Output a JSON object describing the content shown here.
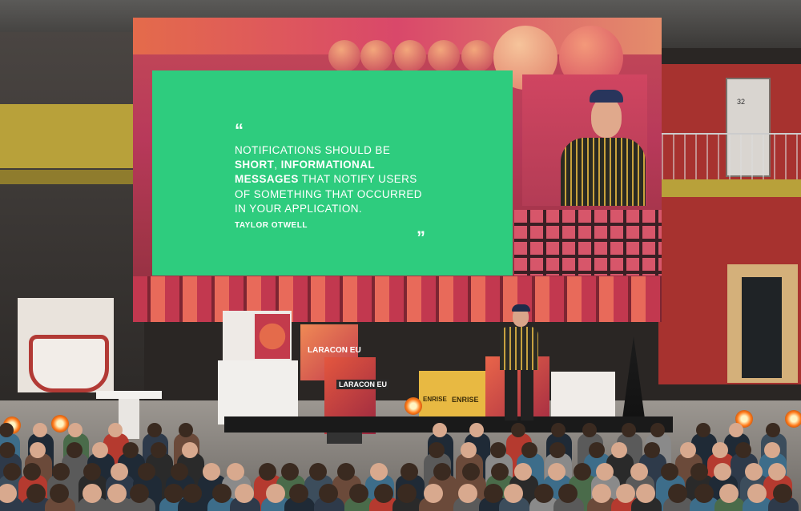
{
  "slide": {
    "quote_open": "“",
    "quote_line1": "NOTIFICATIONS SHOULD BE",
    "quote_bold1": "SHORT",
    "quote_sep": ", ",
    "quote_bold2": "INFORMATIONAL",
    "quote_bold3": "MESSAGES",
    "quote_line3_rest": " THAT NOTIFY USERS",
    "quote_line4": "OF SOMETHING THAT OCCURRED",
    "quote_line5": "IN YOUR APPLICATION.",
    "author": "TAYLOR OTWELL",
    "quote_close": "”",
    "background_color": "#2ecc7e"
  },
  "signage": {
    "door_number": "32",
    "cube_brand_1": "ENRISE",
    "cube_brand_2": "ENRISE",
    "podium_label": "LARACON EU",
    "stack_label": "LARACON EU"
  },
  "colors": {
    "screen_red": "#b8395a",
    "accent_orange": "#e46b4b",
    "wall_red": "#a7322f",
    "cube_yellow": "#e8b942"
  }
}
